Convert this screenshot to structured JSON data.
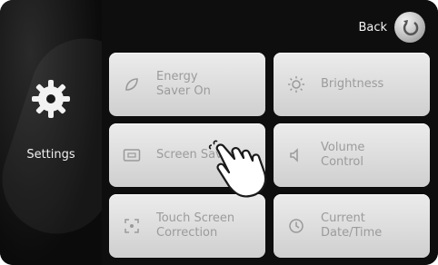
{
  "sidebar": {
    "label": "Settings",
    "icon": "gear-icon"
  },
  "header": {
    "back_label": "Back",
    "back_icon": "back-arrow-icon"
  },
  "tiles": [
    {
      "label": "Energy\nSaver On",
      "icon": "leaf-icon"
    },
    {
      "label": "Brightness",
      "icon": "sun-icon"
    },
    {
      "label": "Screen Saver",
      "icon": "screen-icon"
    },
    {
      "label": "Volume\nControl",
      "icon": "speaker-icon"
    },
    {
      "label": "Touch Screen\nCorrection",
      "icon": "touch-target-icon"
    },
    {
      "label": "Current\nDate/Time",
      "icon": "clock-icon"
    }
  ],
  "colors": {
    "tile_text": "#9b9b9b",
    "background": "#111111",
    "label_text": "#f0f0f0"
  }
}
